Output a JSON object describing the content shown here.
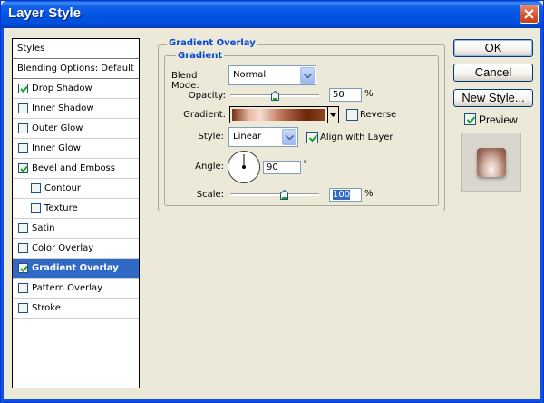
{
  "window": {
    "title": "Layer Style"
  },
  "styles_list": {
    "items": [
      {
        "label": "Styles",
        "checkbox": false,
        "checked": false,
        "selected": false,
        "indent": false,
        "header": true
      },
      {
        "label": "Blending Options: Default",
        "checkbox": false,
        "checked": false,
        "selected": false,
        "indent": false,
        "header": true
      },
      {
        "label": "Drop Shadow",
        "checkbox": true,
        "checked": true,
        "selected": false,
        "indent": false
      },
      {
        "label": "Inner Shadow",
        "checkbox": true,
        "checked": false,
        "selected": false,
        "indent": false
      },
      {
        "label": "Outer Glow",
        "checkbox": true,
        "checked": false,
        "selected": false,
        "indent": false
      },
      {
        "label": "Inner Glow",
        "checkbox": true,
        "checked": false,
        "selected": false,
        "indent": false
      },
      {
        "label": "Bevel and Emboss",
        "checkbox": true,
        "checked": true,
        "selected": false,
        "indent": false
      },
      {
        "label": "Contour",
        "checkbox": true,
        "checked": false,
        "selected": false,
        "indent": true
      },
      {
        "label": "Texture",
        "checkbox": true,
        "checked": false,
        "selected": false,
        "indent": true
      },
      {
        "label": "Satin",
        "checkbox": true,
        "checked": false,
        "selected": false,
        "indent": false
      },
      {
        "label": "Color Overlay",
        "checkbox": true,
        "checked": false,
        "selected": false,
        "indent": false
      },
      {
        "label": "Gradient Overlay",
        "checkbox": true,
        "checked": true,
        "selected": true,
        "indent": false
      },
      {
        "label": "Pattern Overlay",
        "checkbox": true,
        "checked": false,
        "selected": false,
        "indent": false
      },
      {
        "label": "Stroke",
        "checkbox": true,
        "checked": false,
        "selected": false,
        "indent": false
      }
    ]
  },
  "panel": {
    "group_title": "Gradient Overlay",
    "subgroup_title": "Gradient",
    "blend_mode": {
      "label": "Blend Mode:",
      "value": "Normal"
    },
    "opacity": {
      "label": "Opacity:",
      "value": "50",
      "unit": "%",
      "level_percent": 50
    },
    "gradient": {
      "label": "Gradient:",
      "reverse_label": "Reverse",
      "reverse_checked": false
    },
    "style": {
      "label": "Style:",
      "value": "Linear",
      "align_label": "Align with Layer",
      "align_checked": true
    },
    "angle": {
      "label": "Angle:",
      "value": "90",
      "unit": "°",
      "degrees": 90
    },
    "scale": {
      "label": "Scale:",
      "value": "100",
      "unit": "%",
      "level_percent": 60
    }
  },
  "buttons": {
    "ok": "OK",
    "cancel": "Cancel",
    "new_style": "New Style...",
    "preview_label": "Preview",
    "preview_checked": true
  },
  "colors": {
    "selection": "#316ac5",
    "group_title": "#0046d5",
    "titlebar": "#0054e3"
  }
}
